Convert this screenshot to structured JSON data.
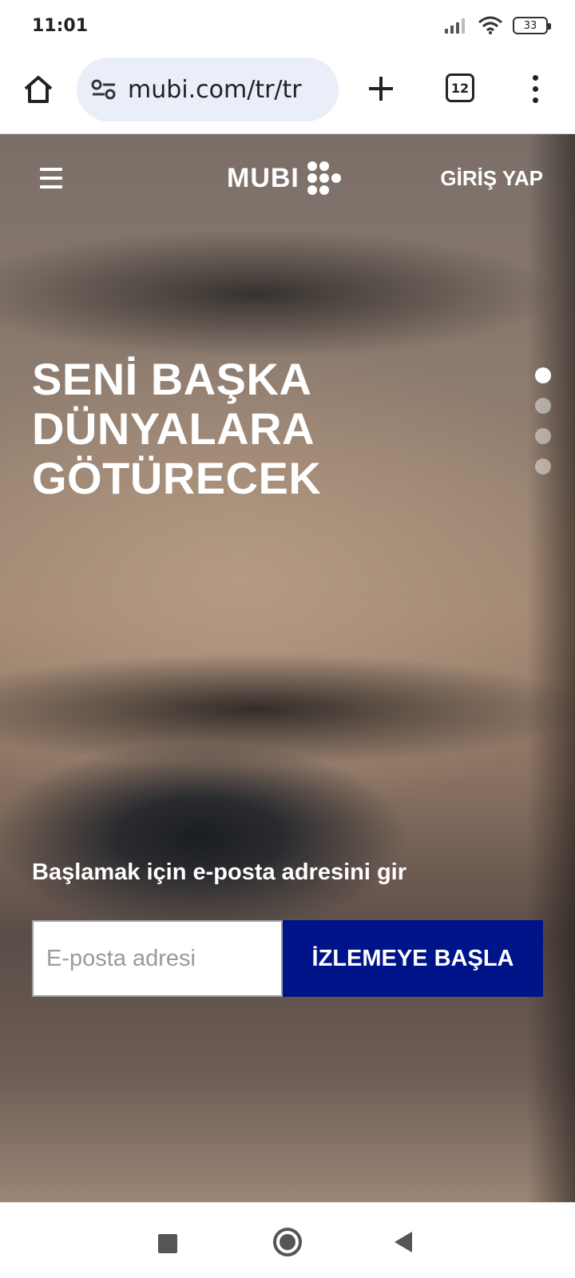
{
  "status_bar": {
    "time": "11:01",
    "battery": "33",
    "icons": [
      "signal-icon",
      "wifi-icon",
      "battery-icon"
    ]
  },
  "browser": {
    "url": "mubi.com/tr/tr",
    "tab_count": "12",
    "icons": [
      "home-icon",
      "site-settings-icon",
      "new-tab-plus-icon",
      "tab-switcher-icon",
      "more-menu-icon"
    ]
  },
  "header": {
    "logo_text": "MUBI",
    "login_label": "GİRİŞ YAP"
  },
  "hero": {
    "headline_lines": [
      "SENİ BAŞKA",
      "DÜNYALARA",
      "GÖTÜRECEK"
    ],
    "slides": 4,
    "active_slide": 1
  },
  "signup": {
    "label": "Başlamak için e-posta adresini gir",
    "email_placeholder": "E-posta adresi",
    "button_label": "İZLEMEYE BAŞLA",
    "button_color": "#001489"
  },
  "system_nav": {
    "icons": [
      "recents-square-icon",
      "home-circle-icon",
      "back-triangle-icon"
    ]
  }
}
